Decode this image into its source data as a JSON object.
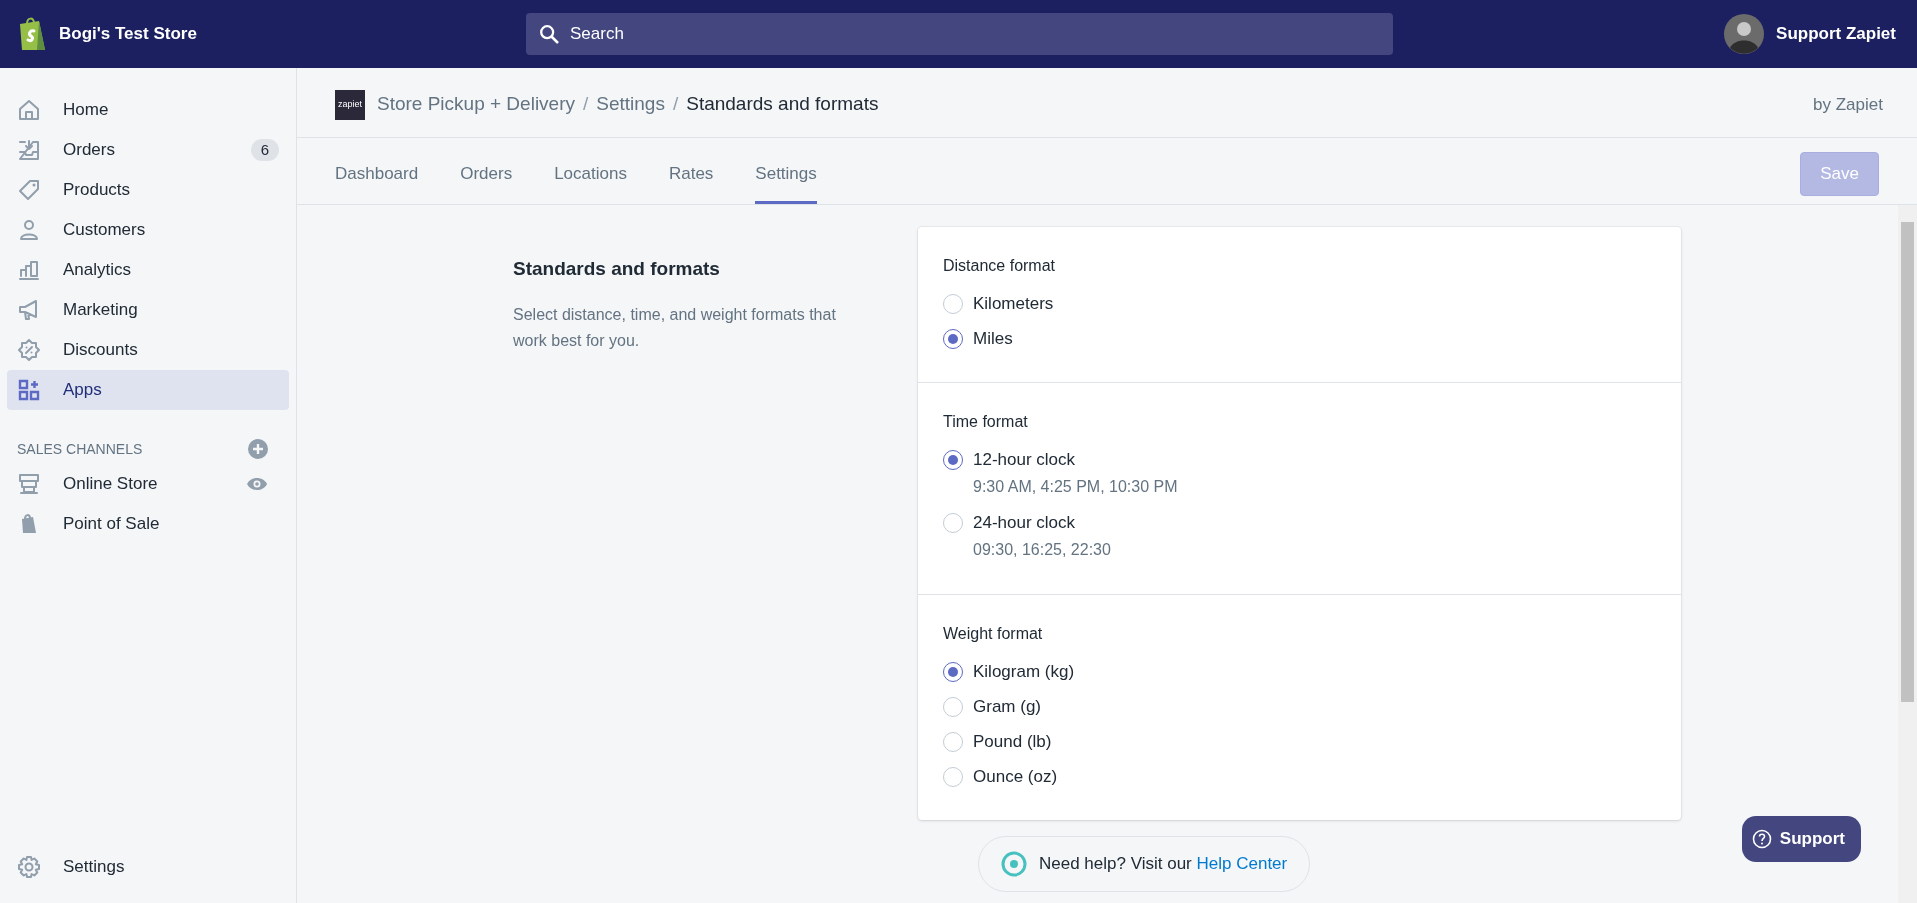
{
  "topbar": {
    "store_name": "Bogi's Test Store",
    "search": {
      "placeholder": "Search"
    },
    "user_name": "Support Zapiet"
  },
  "sidebar": {
    "items": [
      {
        "label": "Home",
        "selected": false
      },
      {
        "label": "Orders",
        "selected": false,
        "badge": "6"
      },
      {
        "label": "Products",
        "selected": false
      },
      {
        "label": "Customers",
        "selected": false
      },
      {
        "label": "Analytics",
        "selected": false
      },
      {
        "label": "Marketing",
        "selected": false
      },
      {
        "label": "Discounts",
        "selected": false
      },
      {
        "label": "Apps",
        "selected": true
      }
    ],
    "sales_channels": {
      "heading": "SALES CHANNELS",
      "items": [
        {
          "label": "Online Store"
        },
        {
          "label": "Point of Sale"
        }
      ]
    },
    "footer_item": {
      "label": "Settings"
    }
  },
  "header": {
    "logo": "zapiet",
    "breadcrumbs": [
      "Store Pickup + Delivery",
      "Settings",
      "Standards and formats"
    ],
    "separator": "/",
    "by": "by Zapiet"
  },
  "tabs": [
    {
      "label": "Dashboard",
      "selected": false
    },
    {
      "label": "Orders",
      "selected": false
    },
    {
      "label": "Locations",
      "selected": false
    },
    {
      "label": "Rates",
      "selected": false
    },
    {
      "label": "Settings",
      "selected": true
    }
  ],
  "save_button": {
    "label": "Save",
    "disabled": true
  },
  "section": {
    "title": "Standards and formats",
    "description": "Select distance, time, and weight formats that work best for you."
  },
  "groups": [
    {
      "title": "Distance format",
      "options": [
        {
          "label": "Kilometers",
          "selected": false
        },
        {
          "label": "Miles",
          "selected": true
        }
      ]
    },
    {
      "title": "Time format",
      "options": [
        {
          "label": "12-hour clock",
          "selected": true,
          "example": "9:30 AM, 4:25 PM, 10:30 PM"
        },
        {
          "label": "24-hour clock",
          "selected": false,
          "example": "09:30, 16:25, 22:30"
        }
      ]
    },
    {
      "title": "Weight format",
      "options": [
        {
          "label": "Kilogram (kg)",
          "selected": true
        },
        {
          "label": "Gram (g)",
          "selected": false
        },
        {
          "label": "Pound (lb)",
          "selected": false
        },
        {
          "label": "Ounce (oz)",
          "selected": false
        }
      ]
    }
  ],
  "help": {
    "text": "Need help? Visit our ",
    "link": "Help Center"
  },
  "support_button": {
    "label": "Support"
  }
}
